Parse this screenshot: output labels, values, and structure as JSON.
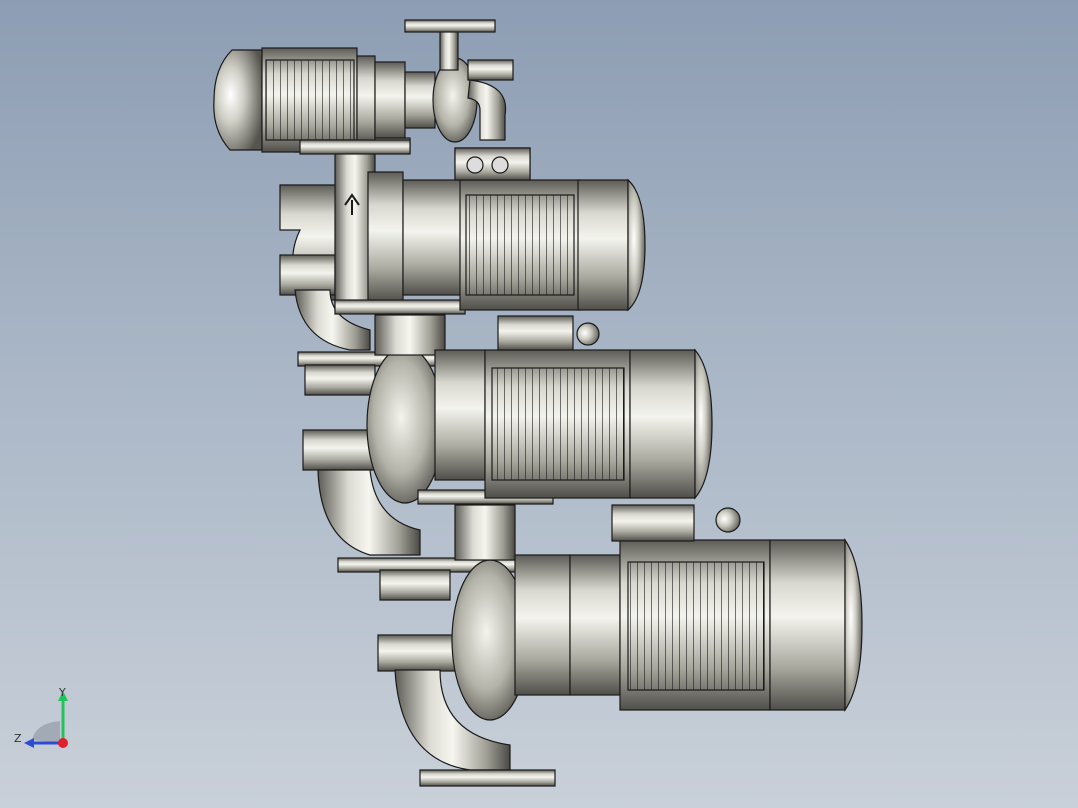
{
  "viewport": {
    "background_top": "#8d9db3",
    "background_bottom": "#c9d0d9",
    "model": {
      "description_icon": "pump-assembly",
      "metal_light": "#f2f2ec",
      "metal_mid": "#b9b8ad",
      "metal_dark": "#5c5b55",
      "edge_color": "#1a1a1a"
    }
  },
  "triad": {
    "x_label": "",
    "y_label": "Y",
    "z_label": "Z",
    "y_color": "#22c35a",
    "z_color": "#2d4bd8",
    "origin_color": "#e0202a"
  }
}
